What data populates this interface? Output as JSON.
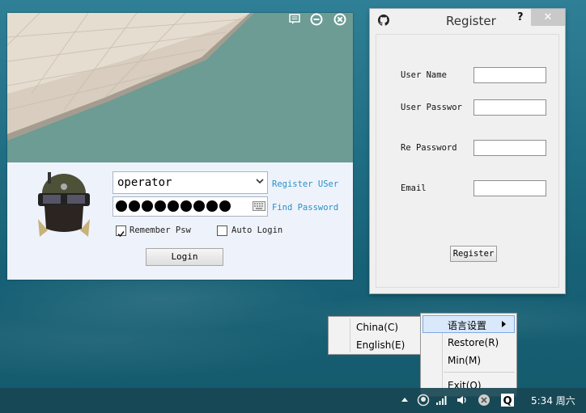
{
  "login": {
    "username_value": "operator",
    "password_dot_count": 9,
    "register_link": "Register USer",
    "find_password_link": "Find Password",
    "remember_label": "Remember Psw",
    "remember_checked": true,
    "auto_login_label": "Auto Login",
    "auto_login_checked": false,
    "login_button": "Login"
  },
  "register": {
    "title": "Register",
    "help_glyph": "?",
    "close_glyph": "✕",
    "fields": [
      {
        "label": "User Name"
      },
      {
        "label": "User Passwor"
      },
      {
        "label": "Re Password"
      },
      {
        "label": "Email"
      }
    ],
    "submit_button": "Register"
  },
  "context_menu": {
    "items": [
      {
        "label": "语言设置",
        "has_submenu": true
      },
      {
        "label": "Restore(R)"
      },
      {
        "label": "Min(M)"
      },
      {
        "label": "Exit(Q)"
      }
    ]
  },
  "language_submenu": {
    "items": [
      {
        "label": "China(C)"
      },
      {
        "label": "English(E)"
      }
    ]
  },
  "taskbar": {
    "clock": "5:34 周六"
  },
  "icons": {
    "login_chat": "chat-icon",
    "login_min": "minimize-icon",
    "login_close": "close-icon",
    "register_app": "github-icon"
  }
}
